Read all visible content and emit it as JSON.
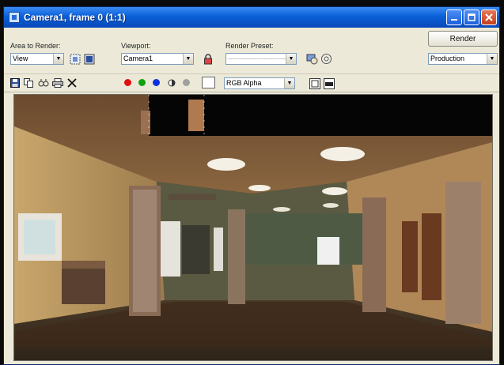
{
  "window": {
    "title": "Camera1, frame 0 (1:1)"
  },
  "toolbar": {
    "area_label": "Area to Render:",
    "area_value": "View",
    "viewport_label": "Viewport:",
    "viewport_value": "Camera1",
    "preset_label": "Render Preset:",
    "preset_value": "-------------------------",
    "render_button": "Render",
    "production_value": "Production"
  },
  "toolbar2": {
    "channel_value": "RGB Alpha",
    "swatch_color": "#ffffff"
  },
  "colors": {
    "title_bar": "#0a5fd8",
    "red_channel": "#e01010",
    "green_channel": "#10a010",
    "blue_channel": "#1030e0"
  }
}
